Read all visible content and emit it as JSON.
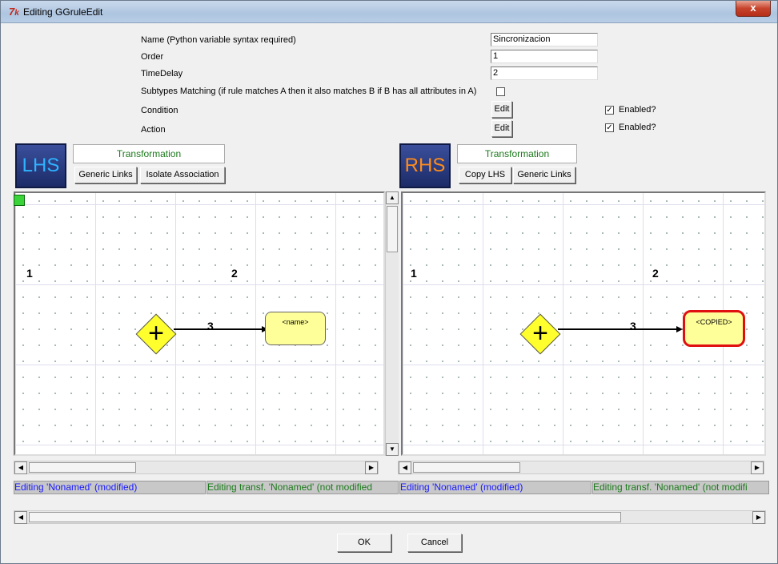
{
  "window": {
    "title": "Editing GGruleEdit",
    "app_icon": "tk-feather-icon",
    "close_label": "x"
  },
  "form": {
    "name_label": "Name (Python variable syntax required)",
    "name_value": "Sincronizacion",
    "order_label": "Order",
    "order_value": "1",
    "timedelay_label": "TimeDelay",
    "timedelay_value": "2",
    "subtypes_label": "Subtypes Matching (if rule matches A then it also matches B if B has all attributes in A)",
    "subtypes_checked": false,
    "condition_label": "Condition",
    "action_label": "Action",
    "edit_label": "Edit",
    "enabled_label": "Enabled?",
    "condition_enabled": true,
    "action_enabled": true
  },
  "lhs": {
    "logo": "LHS",
    "transformation": "Transformation",
    "generic_links": "Generic Links",
    "isolate_association": "Isolate Association",
    "node1": "1",
    "node2": "2",
    "node3": "3",
    "node_text": "<name>",
    "status_left": "Editing 'Nonamed' (modified)",
    "status_right": "Editing transf. 'Nonamed' (not modified"
  },
  "rhs": {
    "logo": "RHS",
    "transformation": "Transformation",
    "copy_lhs": "Copy LHS",
    "generic_links": "Generic Links",
    "node1": "1",
    "node2": "2",
    "node3": "3",
    "node_text": "<COPIED>",
    "status_left": "Editing 'Nonamed' (modified)",
    "status_right": "Editing transf. 'Nonamed' (not modifi"
  },
  "buttons": {
    "ok": "OK",
    "cancel": "Cancel"
  },
  "colors": {
    "lhs_text": "#2fb3ff",
    "rhs_text": "#ff8c1a",
    "status_text": "#1a1aff",
    "status_green": "#1c7a1c",
    "copied_border": "#e01010"
  }
}
